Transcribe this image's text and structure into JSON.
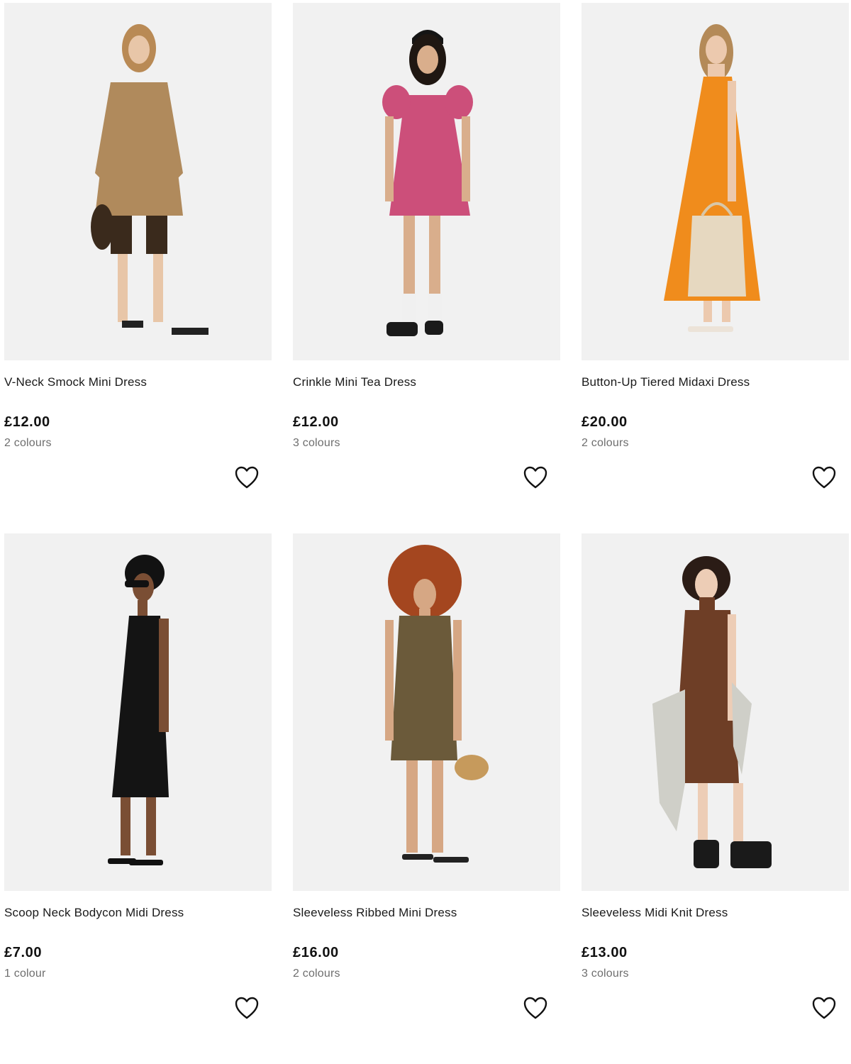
{
  "products": [
    {
      "title": "V-Neck Smock Mini Dress",
      "price": "£12.00",
      "colours": "2 colours",
      "wishlist_icon": "heart-outline-icon",
      "swatch": {
        "dress": "#b08a5c",
        "accent": "#3a2a1c",
        "skin": "#e8c6a8",
        "hair": "#b98a55"
      }
    },
    {
      "title": "Crinkle Mini Tea Dress",
      "price": "£12.00",
      "colours": "3 colours",
      "wishlist_icon": "heart-outline-icon",
      "swatch": {
        "dress": "#cc4f7a",
        "accent": "#1a1a1a",
        "skin": "#d9ae8c",
        "hair": "#1f1712"
      }
    },
    {
      "title": "Button-Up Tiered Midaxi Dress",
      "price": "£20.00",
      "colours": "2 colours",
      "wishlist_icon": "heart-outline-icon",
      "swatch": {
        "dress": "#f08c1c",
        "accent": "#e6d8c0",
        "skin": "#ecc9ae",
        "hair": "#b48a58"
      }
    },
    {
      "title": "Scoop Neck Bodycon Midi Dress",
      "price": "£7.00",
      "colours": "1 colour",
      "wishlist_icon": "heart-outline-icon",
      "swatch": {
        "dress": "#141414",
        "accent": "#141414",
        "skin": "#7a4e34",
        "hair": "#121212"
      }
    },
    {
      "title": "Sleeveless Ribbed Mini Dress",
      "price": "£16.00",
      "colours": "2 colours",
      "wishlist_icon": "heart-outline-icon",
      "swatch": {
        "dress": "#6b5a3a",
        "accent": "#c69a5c",
        "skin": "#d6a784",
        "hair": "#a4461f"
      }
    },
    {
      "title": "Sleeveless Midi Knit Dress",
      "price": "£13.00",
      "colours": "3 colours",
      "wishlist_icon": "heart-outline-icon",
      "swatch": {
        "dress": "#6e3e26",
        "accent": "#cfcfc8",
        "skin": "#edcdb6",
        "hair": "#2b1c16"
      }
    }
  ]
}
